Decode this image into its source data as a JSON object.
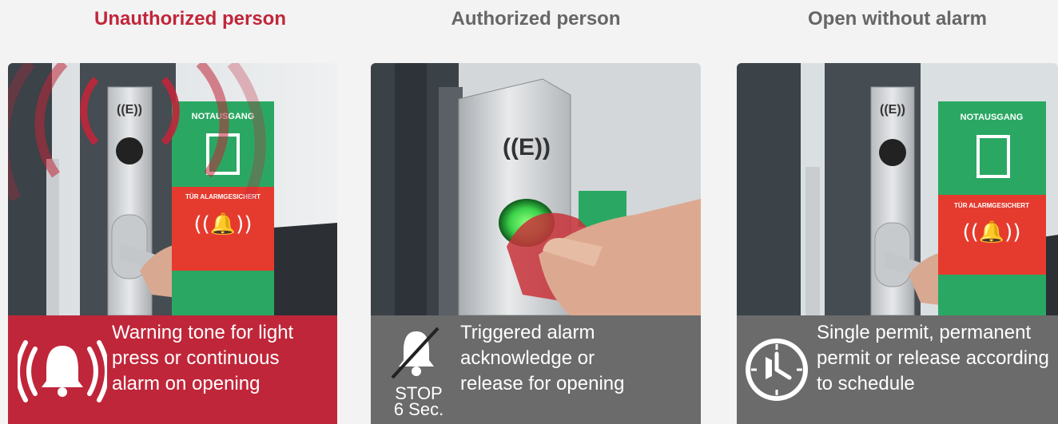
{
  "columns": [
    {
      "title": "Unauthorized person",
      "caption": [
        "Warning tone for light",
        "press or continuous",
        "alarm on opening"
      ],
      "icon": "alarm-bell-icon",
      "sign": {
        "exit": "NOTAUSGANG",
        "alarm": "TÜR ALARMGESICHERT"
      }
    },
    {
      "title": "Authorized person",
      "caption": [
        "Triggered alarm",
        "acknowledge or",
        "release for opening"
      ],
      "icon": "muted-bell-icon",
      "stop": [
        "STOP",
        "6 Sec."
      ]
    },
    {
      "title": "Open without alarm",
      "caption": [
        "Single permit, permanent",
        "permit or release according",
        "to schedule"
      ],
      "icon": "clock-schedule-icon",
      "sign": {
        "exit": "NOTAUSGANG",
        "alarm": "TÜR ALARMGESICHERT"
      }
    }
  ],
  "colors": {
    "alarm_red": "#c0263a",
    "caption_gray": "#6b6b6b",
    "title_gray": "#666666",
    "exit_green": "#2aa863",
    "sign_red": "#e53b2f",
    "led_green": "#3cd14a"
  }
}
